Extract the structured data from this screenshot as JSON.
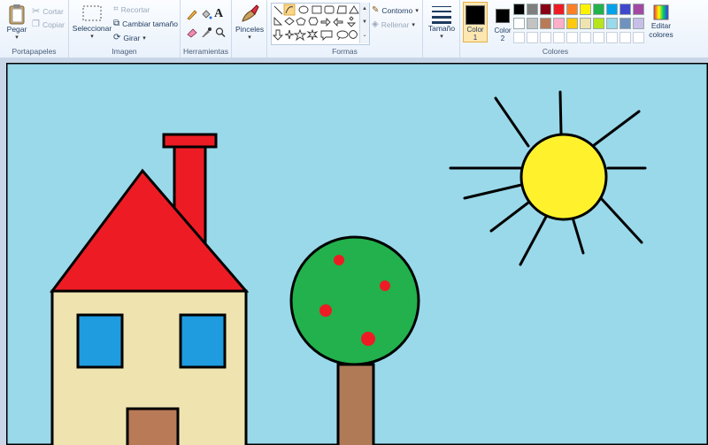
{
  "ribbon": {
    "clipboard": {
      "group_label": "Portapapeles",
      "paste": "Pegar",
      "cut": "Cortar",
      "copy": "Copiar"
    },
    "image": {
      "group_label": "Imagen",
      "select": "Seleccionar",
      "crop": "Recortar",
      "resize": "Cambiar tamaño",
      "rotate": "Girar"
    },
    "tools": {
      "group_label": "Herramientas"
    },
    "brushes": {
      "label": "Pinceles"
    },
    "shapes": {
      "group_label": "Formas",
      "outline": "Contorno",
      "fill": "Rellenar"
    },
    "size": {
      "label": "Tamaño"
    },
    "colors": {
      "group_label": "Colores",
      "color1_line1": "Color",
      "color1_line2": "1",
      "color2_line1": "Color",
      "color2_line2": "2",
      "edit_line1": "Editar",
      "edit_line2": "colores",
      "color1": "#000000",
      "color2": "#ffffff",
      "row1": [
        "#000000",
        "#7f7f7f",
        "#880015",
        "#ed1c24",
        "#ff7f27",
        "#fff200",
        "#22b14c",
        "#00a2e8",
        "#3f48cc",
        "#a349a4"
      ],
      "row2": [
        "#ffffff",
        "#c3c3c3",
        "#b97a57",
        "#ffaec9",
        "#ffc90e",
        "#efe4b0",
        "#b5e61d",
        "#99d9ea",
        "#7092be",
        "#c8bfe7"
      ]
    }
  },
  "drawing": {
    "sky": "#99d9ea",
    "roof": "#ed1c24",
    "wall": "#efe4b0",
    "window": "#1f9be0",
    "door": "#b97a57",
    "sun": "#fff22c",
    "tree_top": "#22b14c",
    "fruit": "#ed1c24",
    "trunk": "#b07a57"
  }
}
